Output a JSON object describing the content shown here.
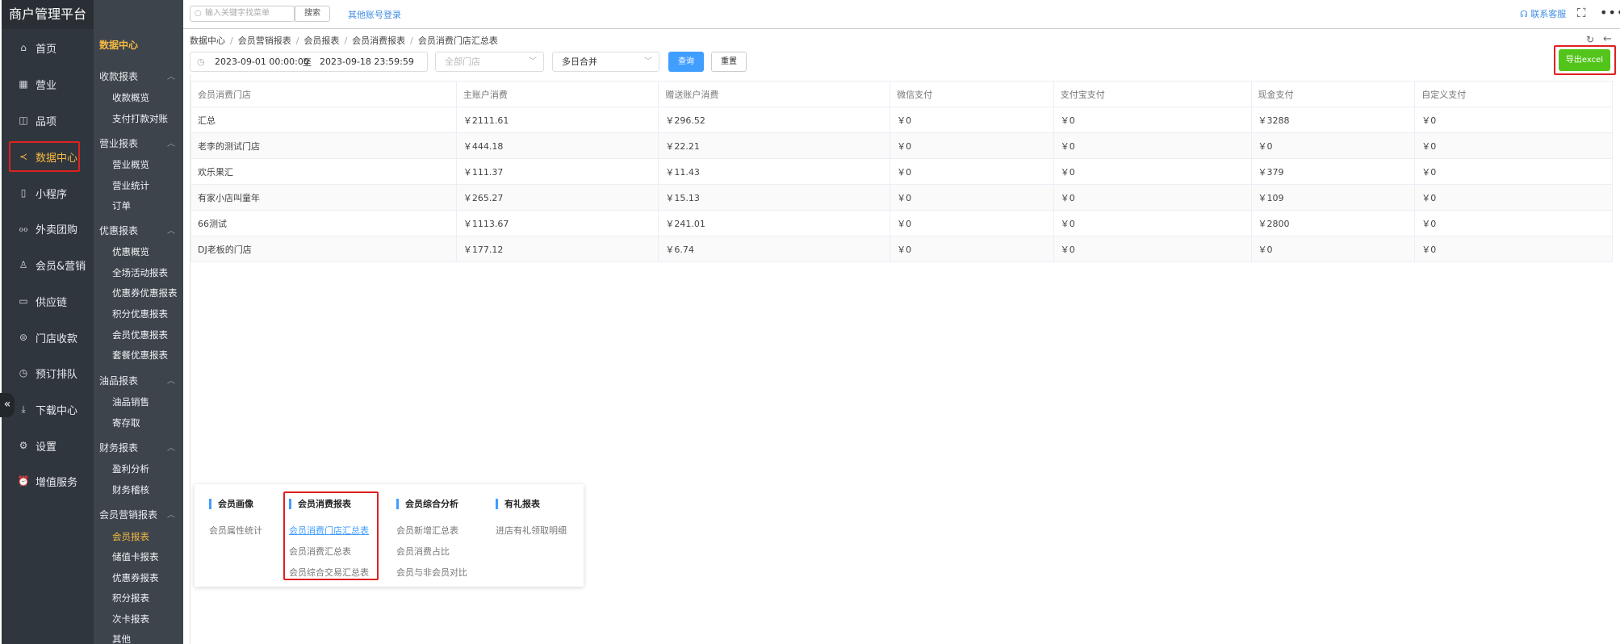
{
  "app": {
    "title": "商户管理平台"
  },
  "sidebar": {
    "items": [
      {
        "label": "首页",
        "icon": "home-icon"
      },
      {
        "label": "营业",
        "icon": "calendar-icon"
      },
      {
        "label": "品项",
        "icon": "bag-icon"
      },
      {
        "label": "数据中心",
        "icon": "share-icon"
      },
      {
        "label": "小程序",
        "icon": "phone-icon"
      },
      {
        "label": "外卖团购",
        "icon": "bike-icon"
      },
      {
        "label": "会员&营销",
        "icon": "user-icon"
      },
      {
        "label": "供应链",
        "icon": "truck-icon"
      },
      {
        "label": "门店收款",
        "icon": "coin-icon"
      },
      {
        "label": "预订排队",
        "icon": "clock-icon"
      },
      {
        "label": "下载中心",
        "icon": "download-icon"
      },
      {
        "label": "设置",
        "icon": "gear-icon"
      },
      {
        "label": "增值服务",
        "icon": "alarm-icon"
      }
    ],
    "active_index": 3,
    "collapse_glyph": "«"
  },
  "submenu": {
    "title": "数据中心",
    "groups": [
      {
        "label": "收款报表",
        "links": [
          "收款概览",
          "支付打款对账"
        ]
      },
      {
        "label": "营业报表",
        "links": [
          "营业概览",
          "营业统计",
          "订单"
        ]
      },
      {
        "label": "优惠报表",
        "links": [
          "优惠概览",
          "全场活动报表",
          "优惠券优惠报表",
          "积分优惠报表",
          "会员优惠报表",
          "套餐优惠报表"
        ]
      },
      {
        "label": "油品报表",
        "links": [
          "油品销售",
          "寄存取"
        ]
      },
      {
        "label": "财务报表",
        "links": [
          "盈利分析",
          "财务稽核"
        ]
      },
      {
        "label": "会员营销报表",
        "links": [
          "会员报表",
          "储值卡报表",
          "优惠券报表",
          "积分报表",
          "次卡报表",
          "其他"
        ]
      }
    ],
    "active_link": "会员报表"
  },
  "topbar": {
    "search_placeholder": "输入关键字找菜单",
    "search_button": "搜索",
    "other_login": "其他账号登录",
    "contact": "联系客服",
    "expand_glyph": "⛶",
    "more_glyph": "•••"
  },
  "breadcrumb": [
    "数据中心",
    "会员营销报表",
    "会员报表",
    "会员消费报表",
    "会员消费门店汇总表"
  ],
  "filters": {
    "date_start": "2023-09-01 00:00:00",
    "date_to": "至",
    "date_end": "2023-09-18 23:59:59",
    "store_placeholder": "全部门店",
    "merge_value": "多日合并",
    "query_button": "查询",
    "reset_button": "重置",
    "export_button": "导出excel"
  },
  "table": {
    "headers": [
      "会员消费门店",
      "主账户消费",
      "赠送账户消费",
      "微信支付",
      "支付宝支付",
      "现金支付",
      "自定义支付"
    ],
    "rows": [
      [
        "汇总",
        "￥2111.61",
        "￥296.52",
        "￥0",
        "￥0",
        "￥3288",
        "￥0"
      ],
      [
        "老李的测试门店",
        "￥444.18",
        "￥22.21",
        "￥0",
        "￥0",
        "￥0",
        "￥0"
      ],
      [
        "欢乐果汇",
        "￥111.37",
        "￥11.43",
        "￥0",
        "￥0",
        "￥379",
        "￥0"
      ],
      [
        "有家小店叫童年",
        "￥265.27",
        "￥15.13",
        "￥0",
        "￥0",
        "￥109",
        "￥0"
      ],
      [
        "66测试",
        "￥1113.67",
        "￥241.01",
        "￥0",
        "￥0",
        "￥2800",
        "￥0"
      ],
      [
        "DJ老板的门店",
        "￥177.12",
        "￥6.74",
        "￥0",
        "￥0",
        "￥0",
        "￥0"
      ]
    ]
  },
  "report_panel": {
    "columns": [
      {
        "title": "会员画像",
        "links": [
          "会员属性统计"
        ]
      },
      {
        "title": "会员消费报表",
        "links": [
          "会员消费门店汇总表",
          "会员消费汇总表",
          "会员综合交易汇总表"
        ]
      },
      {
        "title": "会员综合分析",
        "links": [
          "会员新增汇总表",
          "会员消费占比",
          "会员与非会员对比"
        ]
      },
      {
        "title": "有礼报表",
        "links": [
          "进店有礼领取明细"
        ]
      }
    ],
    "active_link": "会员消费门店汇总表"
  },
  "colors": {
    "sidebar_bg": "#30363d",
    "submenu_bg": "#3d444c",
    "active": "#f5b942",
    "primary": "#409eff",
    "export": "#52c41a",
    "highlight": "#e02020"
  }
}
